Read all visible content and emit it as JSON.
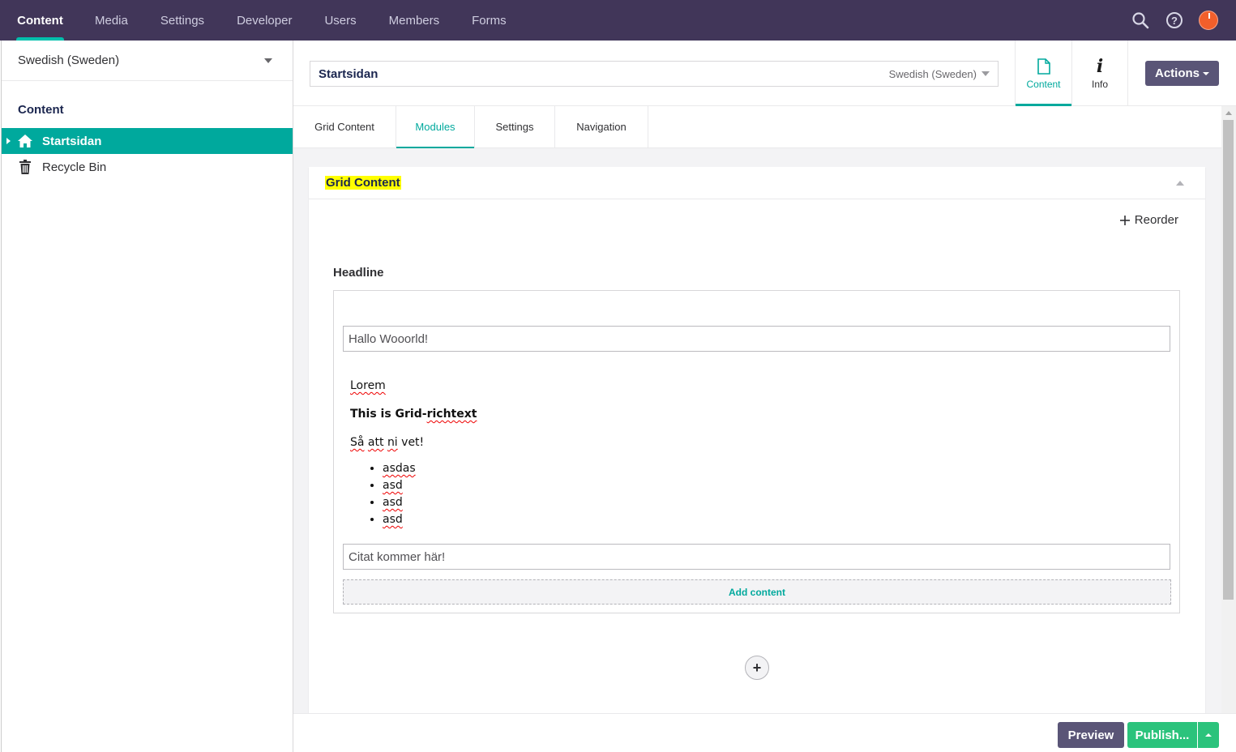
{
  "topnav": {
    "items": [
      {
        "label": "Content",
        "active": true
      },
      {
        "label": "Media"
      },
      {
        "label": "Settings"
      },
      {
        "label": "Developer"
      },
      {
        "label": "Users"
      },
      {
        "label": "Members"
      },
      {
        "label": "Forms"
      }
    ],
    "tools": [
      "search-icon",
      "help-icon",
      "user-avatar"
    ],
    "accent_color": "#00bfad",
    "bg_color": "#413659"
  },
  "sidebar": {
    "language": "Swedish (Sweden)",
    "tree_root": "Content",
    "items": [
      {
        "label": "Startsidan",
        "icon": "home-icon",
        "active": true
      },
      {
        "label": "Recycle Bin",
        "icon": "trash-icon"
      }
    ]
  },
  "editor": {
    "name": "Startsidan",
    "culture": "Swedish (Sweden)",
    "apps": [
      {
        "label": "Content",
        "icon": "document-icon",
        "active": true
      },
      {
        "label": "Info",
        "icon": "info-icon"
      }
    ],
    "actions_label": "Actions",
    "tabs": [
      {
        "label": "Grid Content"
      },
      {
        "label": "Modules",
        "active": true
      },
      {
        "label": "Settings"
      },
      {
        "label": "Navigation"
      }
    ]
  },
  "panel": {
    "title": "Grid Content",
    "reorder_label": "Reorder",
    "headline_label": "Headline",
    "headline_value": "Hallo Wooorld!",
    "rte": {
      "p1": "Lorem",
      "p2_prefix": "This is Grid-",
      "p2_word": "richtext",
      "p3_word1": "Så",
      "p3_word2": "att",
      "p3_word3": "ni",
      "p3_rest": " vet!",
      "list": [
        "asdas",
        "asd",
        "asd",
        "asd"
      ]
    },
    "quote_value": "Citat kommer här!",
    "add_content_label": "Add content",
    "add_row_symbol": "+"
  },
  "footer": {
    "preview_label": "Preview",
    "publish_label": "Publish...",
    "publish_color": "#2bc37c",
    "preview_color": "#5a5577"
  }
}
